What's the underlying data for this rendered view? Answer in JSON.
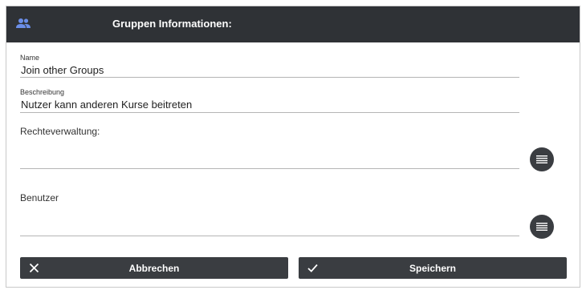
{
  "header": {
    "title": "Gruppen Informationen:",
    "icon": "group-icon",
    "icon_color": "#6b8ee8",
    "background": "#2f3236"
  },
  "fields": {
    "name": {
      "label": "Name",
      "value": "Join other Groups"
    },
    "description": {
      "label": "Beschreibung",
      "value": "Nutzer kann anderen Kurse beitreten"
    }
  },
  "rights": {
    "label": "Rechteverwaltung:",
    "button_icon": "list-icon"
  },
  "users": {
    "label": "Benutzer",
    "button_icon": "list-icon"
  },
  "actions": {
    "cancel": {
      "label": "Abbrechen",
      "icon": "close-icon"
    },
    "save": {
      "label": "Speichern",
      "icon": "check-icon"
    }
  }
}
